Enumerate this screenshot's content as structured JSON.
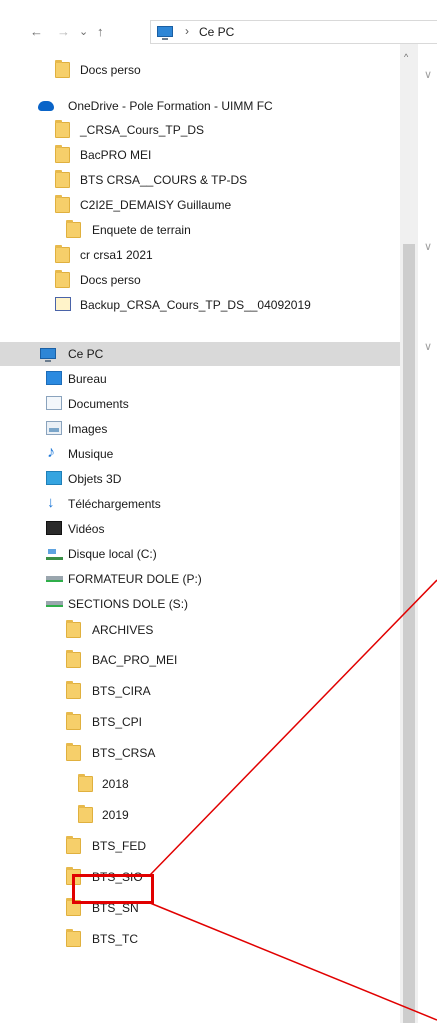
{
  "window": {
    "address_path": "Ce PC",
    "nav": {
      "back": "←",
      "forward": "→",
      "recent": "⌄",
      "up": "↑",
      "sep": "›"
    }
  },
  "tree": {
    "items": [
      {
        "label": "Docs perso",
        "icon": "folder-icon"
      },
      {
        "label": "OneDrive - Pole Formation - UIMM FC",
        "icon": "onedrive-cloud-icon"
      },
      {
        "label": "_CRSA_Cours_TP_DS",
        "icon": "folder-icon"
      },
      {
        "label": "BacPRO MEI",
        "icon": "folder-icon"
      },
      {
        "label": "BTS CRSA__COURS & TP-DS",
        "icon": "folder-icon"
      },
      {
        "label": "C2I2E_DEMAISY Guillaume",
        "icon": "folder-icon"
      },
      {
        "label": "Enquete de terrain",
        "icon": "folder-icon"
      },
      {
        "label": "cr crsa1 2021",
        "icon": "folder-icon"
      },
      {
        "label": "Docs perso",
        "icon": "folder-icon"
      },
      {
        "label": "Backup_CRSA_Cours_TP_DS__04092019",
        "icon": "backup-file-icon"
      },
      {
        "label": "Ce PC",
        "icon": "computer-icon",
        "selected": true
      },
      {
        "label": "Bureau",
        "icon": "desktop-icon"
      },
      {
        "label": "Documents",
        "icon": "documents-icon"
      },
      {
        "label": "Images",
        "icon": "pictures-icon"
      },
      {
        "label": "Musique",
        "icon": "music-icon"
      },
      {
        "label": "Objets 3D",
        "icon": "3d-objects-icon"
      },
      {
        "label": "Téléchargements",
        "icon": "downloads-icon"
      },
      {
        "label": "Vidéos",
        "icon": "videos-icon"
      },
      {
        "label": "Disque local (C:)",
        "icon": "local-disk-icon"
      },
      {
        "label": "FORMATEUR DOLE (P:)",
        "icon": "network-drive-icon"
      },
      {
        "label": "SECTIONS DOLE (S:)",
        "icon": "network-drive-icon"
      },
      {
        "label": "ARCHIVES",
        "icon": "folder-icon"
      },
      {
        "label": "BAC_PRO_MEI",
        "icon": "folder-icon"
      },
      {
        "label": "BTS_CIRA",
        "icon": "folder-icon"
      },
      {
        "label": "BTS_CPI",
        "icon": "folder-icon"
      },
      {
        "label": "BTS_CRSA",
        "icon": "folder-icon"
      },
      {
        "label": "2018",
        "icon": "folder-icon"
      },
      {
        "label": "2019",
        "icon": "folder-icon",
        "highlighted": true
      },
      {
        "label": "BTS_FED",
        "icon": "folder-icon"
      },
      {
        "label": "BTS_SIO",
        "icon": "folder-icon"
      },
      {
        "label": "BTS_SN",
        "icon": "folder-icon"
      },
      {
        "label": "BTS_TC",
        "icon": "folder-icon"
      }
    ]
  },
  "colors": {
    "annotation": "#e10000",
    "selection": "#d9d9d9",
    "folder": "#f6cf6a"
  }
}
